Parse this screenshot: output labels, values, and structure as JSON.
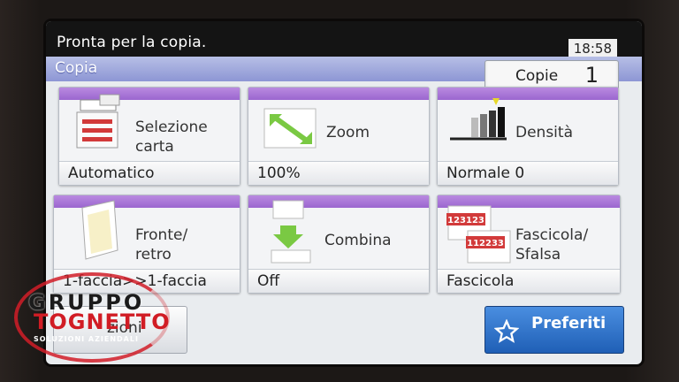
{
  "status": {
    "message": "Pronta per la copia.",
    "clock": "18:58"
  },
  "title": "Copia",
  "copies": {
    "label": "Copie",
    "value": "1"
  },
  "tiles": [
    {
      "label_1": "Selezione",
      "label_2": "carta",
      "value": "Automatico",
      "icon": "paper-tray-icon"
    },
    {
      "label_1": "Zoom",
      "label_2": "",
      "value": "100%",
      "icon": "zoom-icon"
    },
    {
      "label_1": "Densità",
      "label_2": "",
      "value": "Normale 0",
      "icon": "density-icon"
    },
    {
      "label_1": "Fronte/",
      "label_2": "retro",
      "value": "1-faccia>>1-faccia",
      "icon": "duplex-icon"
    },
    {
      "label_1": "Combina",
      "label_2": "",
      "value": "Off",
      "icon": "combine-icon"
    },
    {
      "label_1": "Fascicola/",
      "label_2": "Sfalsa",
      "value": "Fascicola",
      "icon": "collate-icon"
    }
  ],
  "collate_icon_text": [
    "123123",
    "112233"
  ],
  "bottom": {
    "left_label": "zioni",
    "favorites_label": "Preferiti"
  },
  "logo": {
    "line1": "GRUPPO",
    "line2": "TOGNETTO",
    "line3": "SOLUZIONI AZIENDALI"
  },
  "colors": {
    "tile_band": "#9b66cf",
    "title_bar": "#8d96d4",
    "favorites": "#1f5fb6",
    "logo_red": "#d11c24"
  }
}
